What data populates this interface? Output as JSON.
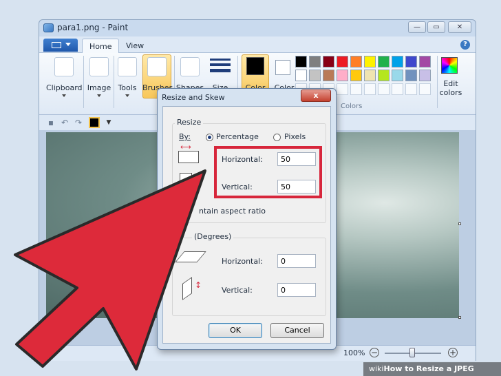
{
  "window": {
    "title": "para1.png - Paint"
  },
  "tabs": [
    {
      "label": "Home"
    },
    {
      "label": "View"
    }
  ],
  "ribbon": {
    "groups": [
      {
        "label": "Clipboard"
      },
      {
        "label": "Image"
      },
      {
        "label": "Tools"
      },
      {
        "label": "Brushes"
      },
      {
        "label": "Shapes"
      },
      {
        "label": "Size"
      },
      {
        "label": "Color"
      },
      {
        "label": "Color"
      }
    ],
    "colors_label": "Colors",
    "edit_colors": "Edit\ncolors",
    "palette_row1": [
      "#000000",
      "#7f7f7f",
      "#880015",
      "#ed1c24",
      "#ff7f27",
      "#fff200",
      "#22b14c",
      "#00a2e8",
      "#3f48cc",
      "#a349a4"
    ],
    "palette_row2": [
      "#ffffff",
      "#c3c3c3",
      "#b97a57",
      "#ffaec9",
      "#ffc90e",
      "#efe4b0",
      "#b5e61d",
      "#99d9ea",
      "#7092be",
      "#c8bfe7"
    ],
    "color1": "#000000",
    "color2": "#ffffff"
  },
  "status": {
    "zoom": "100%"
  },
  "dialog": {
    "title": "Resize and Skew",
    "close": "x",
    "resize_group": "Resize",
    "by_label": "By:",
    "percentage": "Percentage",
    "pixels": "Pixels",
    "horizontal_label": "Horizontal:",
    "horizontal_value": "50",
    "vertical_label": "Vertical:",
    "vertical_value": "50",
    "aspect_ratio": "ntain aspect ratio",
    "skew_group": "(Degrees)",
    "skew_horizontal_label": "Horizontal:",
    "skew_horizontal_value": "0",
    "skew_vertical_label": "Vertical:",
    "skew_vertical_value": "0",
    "ok": "OK",
    "cancel": "Cancel"
  },
  "watermark": {
    "brand": "wiki",
    "text": "How to Resize a JPEG"
  },
  "colors": {
    "highlight": "#d7263b",
    "arrow": "#dd2a3a"
  }
}
